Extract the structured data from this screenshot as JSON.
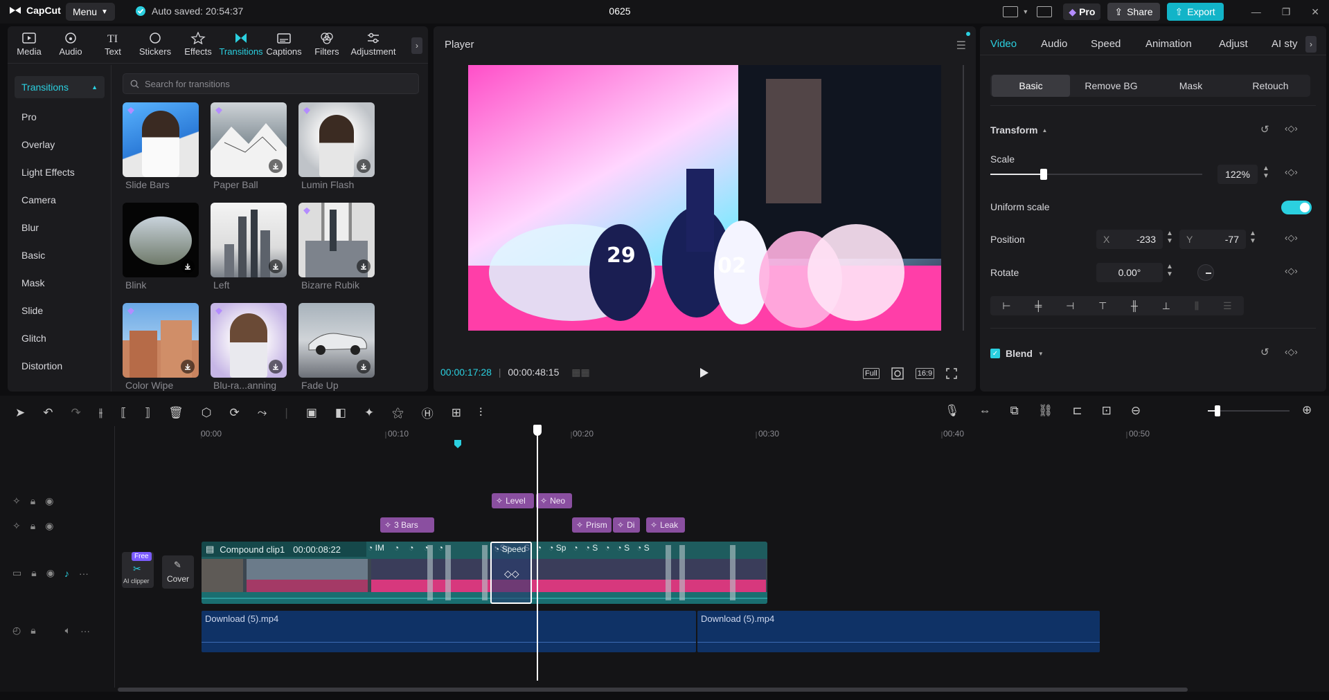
{
  "app": {
    "name": "CapCut",
    "menu_label": "Menu",
    "autosave": "Auto saved: 20:54:37",
    "project_title": "0625"
  },
  "topbar": {
    "pro_label": "Pro",
    "share_label": "Share",
    "export_label": "Export"
  },
  "toolbar": {
    "tools": [
      {
        "label": "Media",
        "icon": "media-icon"
      },
      {
        "label": "Audio",
        "icon": "audio-icon"
      },
      {
        "label": "Text",
        "icon": "text-icon"
      },
      {
        "label": "Stickers",
        "icon": "stickers-icon"
      },
      {
        "label": "Effects",
        "icon": "effects-icon"
      },
      {
        "label": "Transitions",
        "icon": "transitions-icon"
      },
      {
        "label": "Captions",
        "icon": "captions-icon"
      },
      {
        "label": "Filters",
        "icon": "filters-icon"
      },
      {
        "label": "Adjustment",
        "icon": "adjustment-icon"
      }
    ],
    "active": "Transitions"
  },
  "sidebar": {
    "header": "Transitions",
    "items": [
      "Pro",
      "Overlay",
      "Light Effects",
      "Camera",
      "Blur",
      "Basic",
      "Mask",
      "Slide",
      "Glitch",
      "Distortion"
    ]
  },
  "search": {
    "placeholder": "Search for transitions"
  },
  "transitions": [
    {
      "label": "Slide Bars",
      "pro": true,
      "download": false
    },
    {
      "label": "Paper Ball",
      "pro": true,
      "download": true
    },
    {
      "label": "Lumin Flash",
      "pro": true,
      "download": true
    },
    {
      "label": "Blink",
      "pro": false,
      "download": true
    },
    {
      "label": "Left",
      "pro": false,
      "download": true
    },
    {
      "label": "Bizarre Rubik",
      "pro": true,
      "download": true
    },
    {
      "label": "Color Wipe",
      "pro": true,
      "download": true
    },
    {
      "label": "Blu-ra...anning",
      "pro": true,
      "download": true
    },
    {
      "label": "Fade Up",
      "pro": false,
      "download": true
    }
  ],
  "player": {
    "title": "Player",
    "current_time": "00:00:17:28",
    "total_time": "00:00:48:15",
    "full_label": "Full",
    "ratio_label": "16:9"
  },
  "props": {
    "tabs": [
      "Video",
      "Audio",
      "Speed",
      "Animation",
      "Adjust",
      "AI sty"
    ],
    "active_tab": "Video",
    "subtabs": [
      "Basic",
      "Remove BG",
      "Mask",
      "Retouch"
    ],
    "active_subtab": "Basic",
    "transform_label": "Transform",
    "scale_label": "Scale",
    "scale_value": "122%",
    "scale_level": 0.25,
    "uniform_scale_label": "Uniform scale",
    "uniform_scale_on": true,
    "position_label": "Position",
    "pos_x_label": "X",
    "pos_x": "-233",
    "pos_y_label": "Y",
    "pos_y": "-77",
    "rotate_label": "Rotate",
    "rotate_value": "0.00°",
    "blend_label": "Blend"
  },
  "timeline": {
    "ruler": [
      "00:00",
      "00:10",
      "00:20",
      "00:30",
      "00:40",
      "00:50"
    ],
    "effects_row1": [
      "Level",
      "Neo"
    ],
    "effects_row2": [
      "3 Bars",
      "Prism",
      "Di",
      "Leak"
    ],
    "compound_clip": {
      "name": "Compound clip1",
      "duration": "00:00:08:22"
    },
    "clip_labels": [
      "IM",
      "Speed",
      "Sp",
      "S",
      "Sp",
      "S",
      "S",
      "S"
    ],
    "free_badge": "Free",
    "ai_clipper_label": "AI clipper",
    "cover_label": "Cover",
    "audio_clips": [
      "Download (5).mp4",
      "Download (5).mp4"
    ]
  },
  "colors": {
    "accent": "#2bd0e0",
    "export": "#12b4c8",
    "fx_chip": "#8a4fa0",
    "audio": "#0f3266",
    "video_track": "#1e5c5e"
  }
}
